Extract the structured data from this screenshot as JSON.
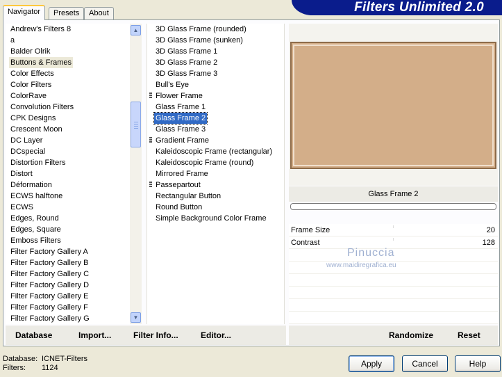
{
  "header": {
    "title": "Filters Unlimited 2.0"
  },
  "tabs": [
    {
      "label": "Navigator",
      "active": true
    },
    {
      "label": "Presets",
      "active": false
    },
    {
      "label": "About",
      "active": false
    }
  ],
  "categories": [
    "Andrew's Filters 8",
    "a",
    "Balder Olrik",
    "Buttons & Frames",
    "Color Effects",
    "Color Filters",
    "ColorRave",
    "Convolution Filters",
    "CPK Designs",
    "Crescent Moon",
    "DC Layer",
    "DCspecial",
    "Distortion Filters",
    "Distort",
    "Déformation",
    "ECWS halftone",
    "ECWS",
    "Edges, Round",
    "Edges, Square",
    "Emboss Filters",
    "Filter Factory Gallery A",
    "Filter Factory Gallery B",
    "Filter Factory Gallery C",
    "Filter Factory Gallery D",
    "Filter Factory Gallery E",
    "Filter Factory Gallery F",
    "Filter Factory Gallery G"
  ],
  "selected_category": "Buttons & Frames",
  "filters": [
    {
      "label": "3D Glass Frame (rounded)",
      "group": false
    },
    {
      "label": "3D Glass Frame (sunken)",
      "group": false
    },
    {
      "label": "3D Glass Frame 1",
      "group": false
    },
    {
      "label": "3D Glass Frame 2",
      "group": false
    },
    {
      "label": "3D Glass Frame 3",
      "group": false
    },
    {
      "label": "Bull's Eye",
      "group": false
    },
    {
      "label": "Flower Frame",
      "group": true
    },
    {
      "label": "Glass Frame 1",
      "group": false
    },
    {
      "label": "Glass Frame 2",
      "group": false
    },
    {
      "label": "Glass Frame 3",
      "group": false
    },
    {
      "label": "Gradient Frame",
      "group": true
    },
    {
      "label": "Kaleidoscopic Frame (rectangular)",
      "group": false
    },
    {
      "label": "Kaleidoscopic Frame (round)",
      "group": false
    },
    {
      "label": "Mirrored Frame",
      "group": false
    },
    {
      "label": "Passepartout",
      "group": true
    },
    {
      "label": "Rectangular Button",
      "group": false
    },
    {
      "label": "Round Button",
      "group": false
    },
    {
      "label": "Simple Background Color Frame",
      "group": false
    }
  ],
  "selected_filter": "Glass Frame 2",
  "preview": {
    "frame_color": "#d3ae89",
    "border_color": "#8e6b49"
  },
  "parameters": [
    {
      "name": "Frame Size",
      "value": "20"
    },
    {
      "name": "Contrast",
      "value": "128"
    }
  ],
  "watermark": {
    "name": "Pinuccia",
    "url": "www.maidiregrafica.eu"
  },
  "bottom_links": {
    "database": "Database",
    "import": "Import...",
    "filter_info": "Filter Info...",
    "editor": "Editor...",
    "randomize": "Randomize",
    "reset": "Reset"
  },
  "status": {
    "database_label": "Database:",
    "database_value": "ICNET-Filters",
    "filters_label": "Filters:",
    "filters_value": "1124"
  },
  "buttons": {
    "apply": "Apply",
    "cancel": "Cancel",
    "help": "Help"
  }
}
